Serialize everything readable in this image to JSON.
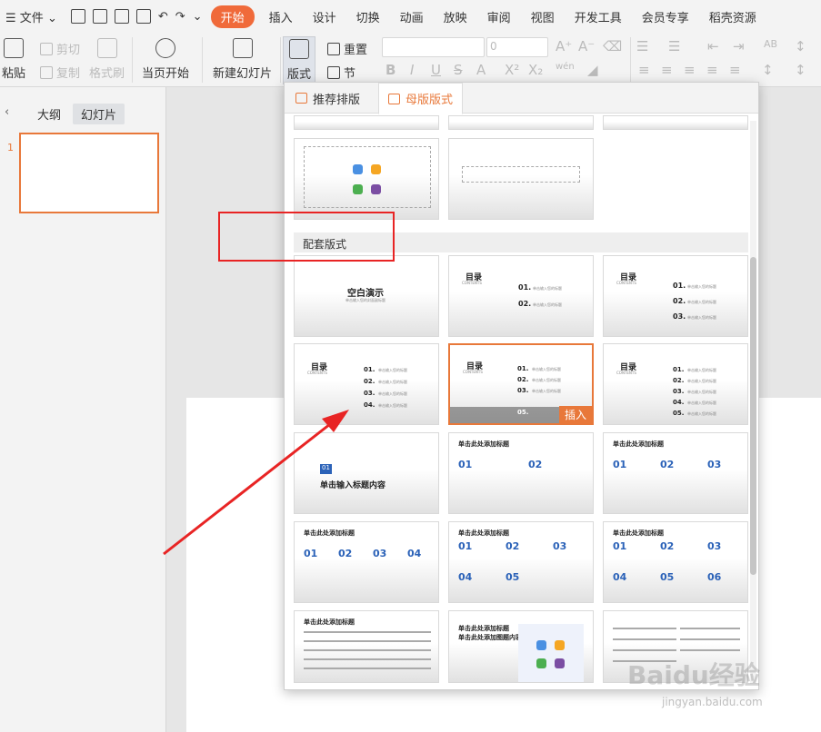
{
  "menu": {
    "hamburger": "☰",
    "file": "文件",
    "tabs": [
      "开始",
      "插入",
      "设计",
      "切换",
      "动画",
      "放映",
      "审阅",
      "视图",
      "开发工具",
      "会员专享",
      "稻壳资源"
    ]
  },
  "ribbon": {
    "paste": "粘贴",
    "cut": "剪切",
    "copy": "复制",
    "format_painter": "格式刷",
    "from_current": "当页开始",
    "new_slide": "新建幻灯片",
    "layout": "版式",
    "reset": "重置",
    "section": "节",
    "font_size": "0",
    "pinyin": "wén"
  },
  "side": {
    "outline": "大纲",
    "slides": "幻灯片",
    "slide_number": "1"
  },
  "popup": {
    "tab_recommended": "推荐排版",
    "tab_master": "母版版式",
    "section_header": "配套版式",
    "insert_label": "插入"
  },
  "cards": {
    "blank_title": "空白演示",
    "blank_sub": "单击输入您的封面副标题",
    "toc": "目录",
    "toc_en": "CONTENTS",
    "n01": "01.",
    "n02": "02.",
    "n03": "03.",
    "n04": "04.",
    "n05": "05.",
    "toc_item": "单击输入您的标题",
    "click_title": "单击输入标题内容",
    "add_title": "单击此处添加标题",
    "d01": "01",
    "d02": "02",
    "d03": "03",
    "d04": "04",
    "d05": "05",
    "d06": "06",
    "block_title": "单击此处添加标题",
    "add_title2": "单击此处添加图题内容"
  },
  "watermark": {
    "brand": "Baidu经验",
    "url": "jingyan.baidu.com"
  },
  "colors": {
    "accent": "#e8783a",
    "red": "#e82424",
    "blue": "#2b62b8"
  }
}
